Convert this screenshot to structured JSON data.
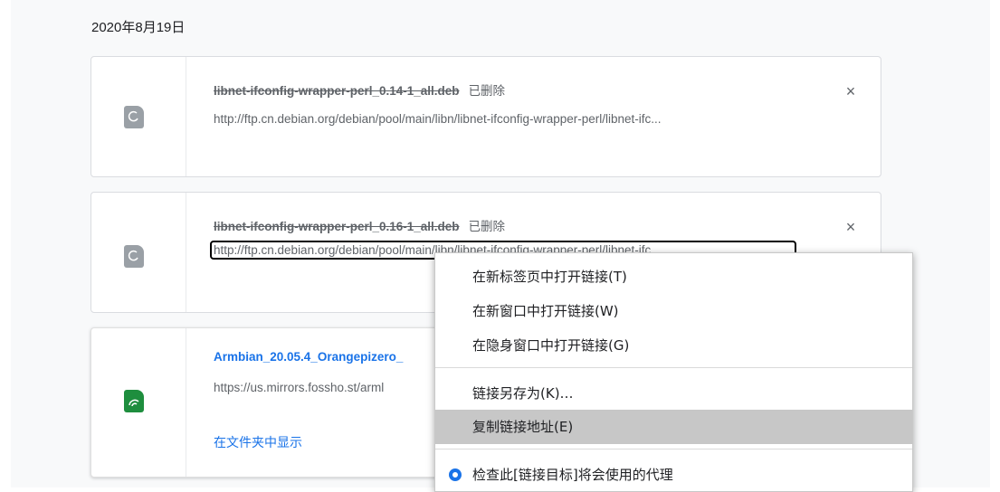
{
  "date_header": "2020年8月19日",
  "downloads": [
    {
      "filename": "libnet-ifconfig-wrapper-perl_0.14-1_all.deb",
      "status": "已删除",
      "url": "http://ftp.cn.debian.org/debian/pool/main/libn/libnet-ifconfig-wrapper-perl/libnet-ifc...",
      "close_label": "×",
      "icon": "debian-file-icon"
    },
    {
      "filename": "libnet-ifconfig-wrapper-perl_0.16-1_all.deb",
      "status": "已删除",
      "url": "http://ftp.cn.debian.org/debian/pool/main/libn/libnet-ifconfig-wrapper-perl/libnet-ifc...",
      "close_label": "×",
      "icon": "debian-file-icon"
    },
    {
      "filename": "Armbian_20.05.4_Orangepizero_",
      "url": "https://us.mirrors.fossho.st/arml",
      "show_in_folder": "在文件夹中显示",
      "icon": "torrent-file-icon"
    }
  ],
  "context_menu": {
    "items": [
      "在新标签页中打开链接(T)",
      "在新窗口中打开链接(W)",
      "在隐身窗口中打开链接(G)",
      "链接另存为(K)…",
      "复制链接地址(E)",
      "检查此[链接目标]将会使用的代理"
    ],
    "hovered_index": 4
  },
  "colors": {
    "link": "#1a73e8",
    "text_secondary": "#5f6368",
    "menu_hover": "#c7c7c7",
    "deb_icon": "#9aa0a6",
    "torrent_icon": "#1e8e3e"
  }
}
